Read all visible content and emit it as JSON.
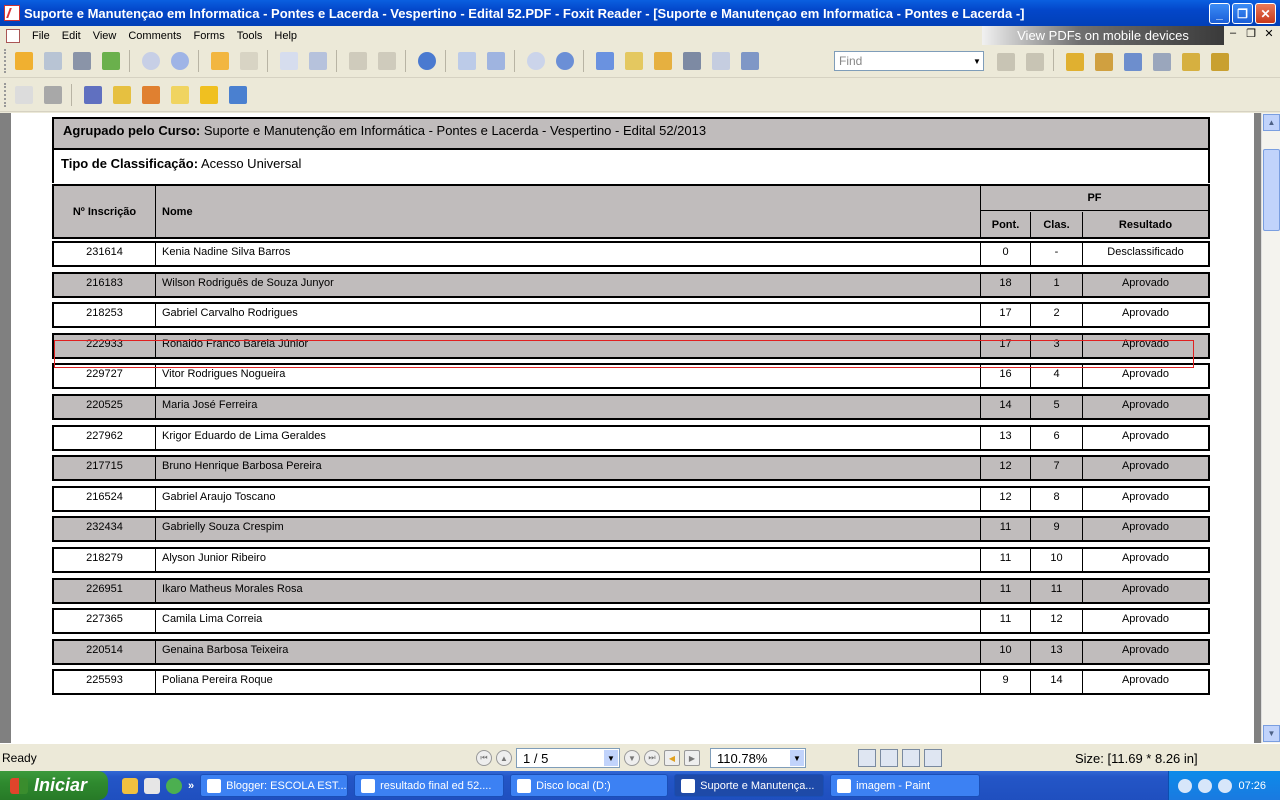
{
  "window": {
    "title": "Suporte e Manutençao em Informatica - Pontes e Lacerda - Vespertino - Edital 52.PDF - Foxit Reader - [Suporte e Manutençao em Informatica - Pontes e Lacerda -]",
    "min": "_",
    "max": "❐",
    "close": "✕"
  },
  "menu": {
    "items": [
      "File",
      "Edit",
      "View",
      "Comments",
      "Forms",
      "Tools",
      "Help"
    ],
    "promo": "View PDFs on mobile devices"
  },
  "toolbar": {
    "find_placeholder": "Find",
    "icons": [
      "open-icon",
      "save-icon",
      "print-icon",
      "email-icon",
      "scroll-up-icon",
      "scroll-down-icon",
      "back-icon",
      "forward-icon",
      "insert-page-icon",
      "extract-page-icon",
      "undo-icon",
      "redo-icon",
      "zoom-icon",
      "fit-page-icon",
      "fit-width-icon",
      "zoom-out-icon",
      "zoom-in-icon",
      "hand-tool-icon",
      "text-select-icon",
      "select-icon",
      "find-icon",
      "typewriter-icon",
      "snapshot-icon"
    ]
  },
  "report": {
    "grouped_label": "Agrupado pelo Curso:",
    "grouped_value": "Suporte e Manutenção em Informática - Pontes e Lacerda - Vespertino - Edital 52/2013",
    "type_label": "Tipo de Classificação:",
    "type_value": "Acesso Universal",
    "col_inscricao": "Nº Inscrição",
    "col_nome": "Nome",
    "col_pf": "PF",
    "col_pont": "Pont.",
    "col_clas": "Clas.",
    "col_resultado": "Resultado",
    "rows": [
      {
        "id": "231614",
        "name": "Kenia Nadine Silva Barros",
        "pont": "0",
        "clas": "-",
        "result": "Desclassificado"
      },
      {
        "id": "216183",
        "name": "Wilson Rodriguês de Souza Junyor",
        "pont": "18",
        "clas": "1",
        "result": "Aprovado"
      },
      {
        "id": "218253",
        "name": "Gabriel Carvalho Rodrigues",
        "pont": "17",
        "clas": "2",
        "result": "Aprovado"
      },
      {
        "id": "222933",
        "name": "Ronaldo Franco Barela Júnior",
        "pont": "17",
        "clas": "3",
        "result": "Aprovado"
      },
      {
        "id": "229727",
        "name": "Vitor Rodrigues Nogueira",
        "pont": "16",
        "clas": "4",
        "result": "Aprovado"
      },
      {
        "id": "220525",
        "name": "Maria José Ferreira",
        "pont": "14",
        "clas": "5",
        "result": "Aprovado"
      },
      {
        "id": "227962",
        "name": "Krigor Eduardo de Lima Geraldes",
        "pont": "13",
        "clas": "6",
        "result": "Aprovado"
      },
      {
        "id": "217715",
        "name": "Bruno Henrique Barbosa  Pereira",
        "pont": "12",
        "clas": "7",
        "result": "Aprovado"
      },
      {
        "id": "216524",
        "name": "Gabriel Araujo Toscano",
        "pont": "12",
        "clas": "8",
        "result": "Aprovado"
      },
      {
        "id": "232434",
        "name": "Gabrielly Souza Crespim",
        "pont": "11",
        "clas": "9",
        "result": "Aprovado"
      },
      {
        "id": "218279",
        "name": "Alyson Junior Ribeiro",
        "pont": "11",
        "clas": "10",
        "result": "Aprovado"
      },
      {
        "id": "226951",
        "name": "Ikaro Matheus Morales Rosa",
        "pont": "11",
        "clas": "11",
        "result": "Aprovado"
      },
      {
        "id": "227365",
        "name": "Camila Lima Correia",
        "pont": "11",
        "clas": "12",
        "result": "Aprovado"
      },
      {
        "id": "220514",
        "name": "Genaina Barbosa Teixeira",
        "pont": "10",
        "clas": "13",
        "result": "Aprovado"
      },
      {
        "id": "225593",
        "name": "Poliana Pereira Roque",
        "pont": "9",
        "clas": "14",
        "result": "Aprovado"
      }
    ]
  },
  "status": {
    "ready": "Ready",
    "page": "1 / 5",
    "zoom": "110.78%",
    "size": "Size: [11.69 * 8.26 in]"
  },
  "taskbar": {
    "start": "Iniciar",
    "tasks": [
      "Blogger: ESCOLA EST...",
      "resultado final ed 52....",
      "Disco local (D:)",
      "Suporte e Manutença...",
      "imagem - Paint"
    ],
    "clock": "07:26"
  }
}
